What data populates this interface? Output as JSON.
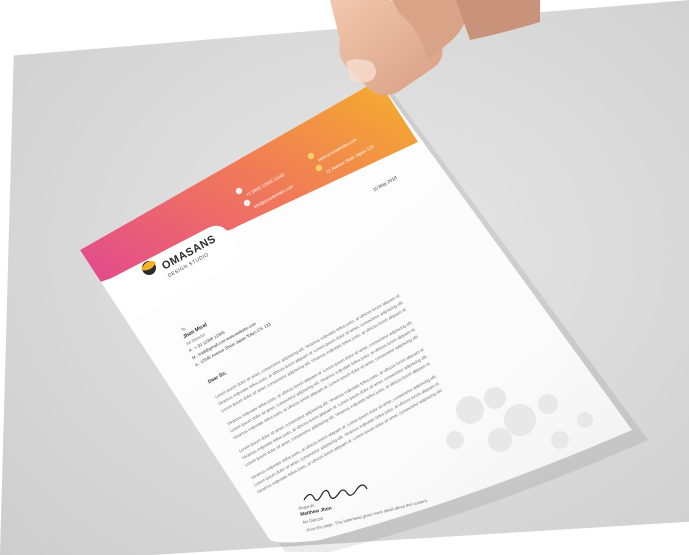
{
  "letterhead": {
    "brand": {
      "name": "OMASANS",
      "tagline": "DESIGN STUDIO"
    },
    "date": "10 May 2018",
    "contacts": [
      {
        "icon": "phone-icon",
        "text": "+1 (000) 12345 12345"
      },
      {
        "icon": "mail-icon",
        "text": "info@yourdomain.com"
      },
      {
        "icon": "globe-icon",
        "text": "www.yourwebsite.com"
      },
      {
        "icon": "location-icon",
        "text": "12 Avenue State Japan 123"
      }
    ],
    "recipient": {
      "to": "To",
      "name": "Jhon Micel",
      "role": "Art Director",
      "lines": [
        "P : + 00 12345 12345",
        "M : mail@gmail.com www.website.com",
        "A : 12345 Avenue Street Japan Tokyo CS. 123"
      ]
    },
    "salutation": "Dear Sir,",
    "body": [
      "Lorem ipsum dolor sit amet, consectetur adipiscing elit. Vivamus vulputate tellus justo, at ultrices lorem aliquam id.",
      "Vivamus vulputate tellus justo, at ultrices lorem aliquam id. Lorem ipsum dolor sit amet, consectetur adipiscing elit.",
      "Lorem ipsum dolor sit amet, consectetur adipiscing elit. Vivamus vulputate tellus justo, at ultrices lorem aliquam id.",
      "Vivamus vulputate tellus justo, at ultrices lorem aliquam id. Lorem ipsum dolor sit amet, consectetur adipiscing elit.",
      "Lorem ipsum dolor sit amet, consectetur adipiscing elit. Vivamus vulputate tellus justo, at ultrices lorem aliquam id.",
      "Vivamus vulputate tellus justo, at ultrices lorem aliquam id. Lorem ipsum dolor sit amet, consectetur adipiscing elit.",
      "Lorem ipsum dolor sit amet, consectetur adipiscing elit. Vivamus vulputate tellus justo, at ultrices lorem aliquam id.",
      "Vivamus vulputate tellus justo, at ultrices lorem aliquam id. Lorem ipsum dolor sit amet, consectetur adipiscing elit.",
      "Lorem ipsum dolor sit amet, consectetur adipiscing elit. Vivamus vulputate tellus justo, at ultrices lorem aliquam id.",
      "Vivamus vulputate tellus justo, at ultrices lorem aliquam id. Lorem ipsum dolor sit amet, consectetur adipiscing elit.",
      "Lorem ipsum dolor sit amet, consectetur adipiscing elit. Vivamus vulputate tellus justo, at ultrices lorem aliquam id.",
      "Vivamus vulputate tellus justo, at ultrices lorem aliquam id. Lorem ipsum dolor sit amet, consectetur adipiscing elit."
    ],
    "closing": "Regards,",
    "signer": {
      "name": "Matthew Jhon",
      "role": "Art Director"
    },
    "footer_note": "Print this page. This letterhead gives more detail about this content."
  },
  "colors": {
    "gradient_start": "#e2488f",
    "gradient_mid": "#f0785a",
    "gradient_end": "#f5b12a",
    "paper": "#ffffff",
    "skin": "#e8b89c",
    "backdrop": "#d9d9d9"
  }
}
